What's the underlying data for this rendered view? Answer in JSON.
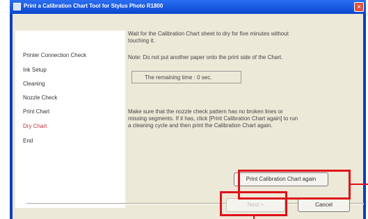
{
  "window": {
    "title": "Print a Calibration Chart Tool for Stylus Photo R1800",
    "close_glyph": "×"
  },
  "sidebar": {
    "items": [
      {
        "label": "Printer Connection Check",
        "active": false
      },
      {
        "label": "Ink Setup",
        "active": false
      },
      {
        "label": "Cleaning",
        "active": false
      },
      {
        "label": "Nozzle Check",
        "active": false
      },
      {
        "label": "Print Chart",
        "active": false
      },
      {
        "label": "Dry Chart",
        "active": true
      },
      {
        "label": "End",
        "active": false
      }
    ]
  },
  "content": {
    "instruction_line1": "Wait for the Calibration Chart sheet to dry for five minutes without",
    "instruction_line2": "touching it.",
    "note": "Note: Do not put another paper onto the print side of the Chart.",
    "timer_text": "The remaining time : 0 sec.",
    "check_line1": "Make sure that the nozzle check pattern has no broken lines or",
    "check_line2": "missing segments. If it has, click [Print Calibration Chart again] to run",
    "check_line3": "a cleaning cycle and then print the Calibration Chart again."
  },
  "buttons": {
    "print_again": "Print Calibration Chart again",
    "next": "Next >",
    "cancel": "Cancel"
  },
  "colors": {
    "titlebar": "#0b47d0",
    "dialog_bg": "#ece9d8",
    "active_step": "#c0303a",
    "highlight": "#e0101a"
  }
}
